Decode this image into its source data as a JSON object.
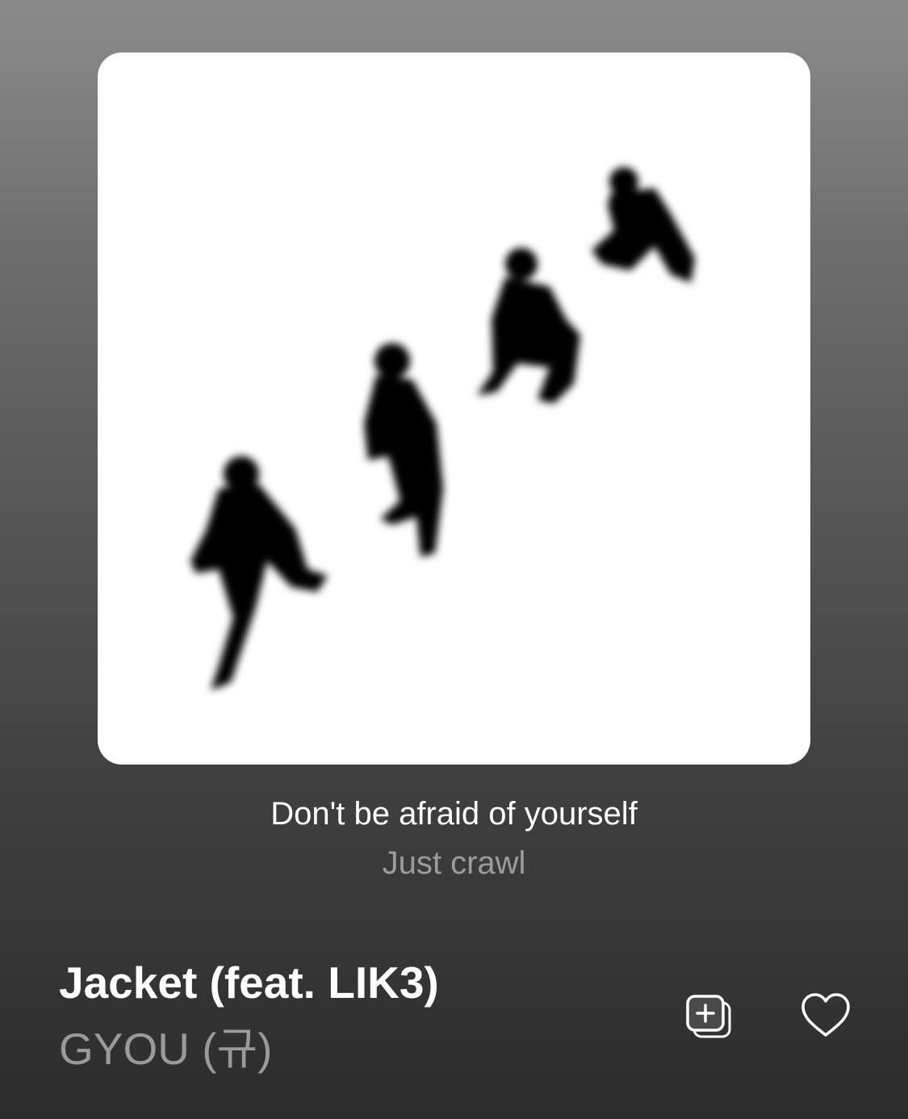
{
  "artwork": {
    "icon": "album-artwork-silhouettes"
  },
  "lyrics": {
    "current": "Don't be afraid of yourself",
    "next": "Just crawl"
  },
  "track": {
    "title": "Jacket (feat. LIK3)",
    "artist": "GYOU (규)"
  },
  "actions": {
    "add_icon": "add-to-library-icon",
    "favorite_icon": "heart-icon"
  },
  "colors": {
    "title": "#ffffff",
    "secondary_text": "#9a9a9a",
    "background_top": "#8b8b8b",
    "background_bottom": "#2c2c2c"
  }
}
